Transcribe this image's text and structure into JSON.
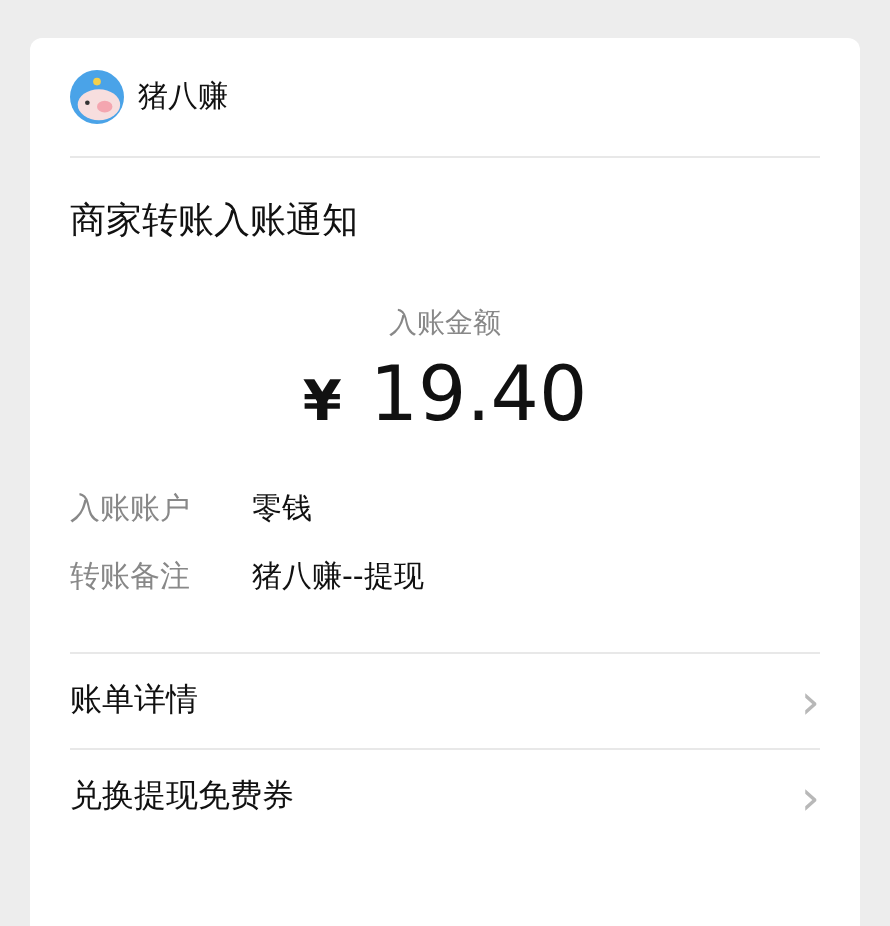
{
  "app": {
    "name": "猪八赚"
  },
  "notice": {
    "title": "商家转账入账通知"
  },
  "amount": {
    "label": "入账金额",
    "currency": "¥",
    "value": "19.40"
  },
  "details": [
    {
      "label": "入账账户",
      "value": "零钱"
    },
    {
      "label": "转账备注",
      "value": "猪八赚--提现"
    }
  ],
  "links": [
    {
      "label": "账单详情",
      "chevron": "›"
    },
    {
      "label": "兑换提现免费券",
      "chevron": "›"
    }
  ]
}
